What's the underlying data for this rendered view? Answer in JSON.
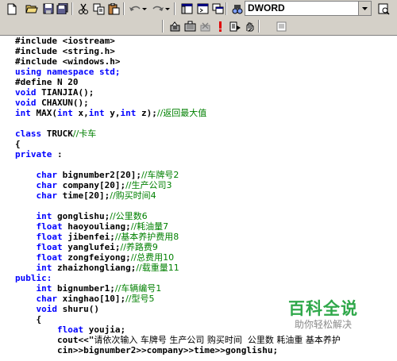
{
  "toolbar": {
    "config_combo": "DWORD",
    "icons": [
      "new-file-icon",
      "open-folder-icon",
      "save-icon",
      "save-all-icon",
      "cut-icon",
      "copy-icon",
      "paste-icon",
      "undo-icon",
      "redo-icon",
      "workspace-icon",
      "output-icon",
      "window-list-icon",
      "find-in-files-icon"
    ]
  },
  "code": [
    [
      {
        "t": "#include <iostream>"
      }
    ],
    [
      {
        "t": "#include <string.h>"
      }
    ],
    [
      {
        "t": "#include <windows.h>"
      }
    ],
    [
      {
        "t": "using namespace std;",
        "c": "kw"
      }
    ],
    [
      {
        "t": "#define N 20"
      }
    ],
    [
      {
        "t": "void",
        "c": "kw"
      },
      {
        "t": " TIANJIA();"
      }
    ],
    [
      {
        "t": "void",
        "c": "kw"
      },
      {
        "t": " CHAXUN();"
      }
    ],
    [
      {
        "t": "int",
        "c": "kw"
      },
      {
        "t": " MAX("
      },
      {
        "t": "int",
        "c": "kw"
      },
      {
        "t": " x,"
      },
      {
        "t": "int",
        "c": "kw"
      },
      {
        "t": " y,"
      },
      {
        "t": "int",
        "c": "kw"
      },
      {
        "t": " z);"
      },
      {
        "t": "//返回最大值",
        "c": "cm"
      }
    ],
    [
      {
        "t": ""
      }
    ],
    [
      {
        "t": "class",
        "c": "kw"
      },
      {
        "t": " TRUCK"
      },
      {
        "t": "//卡车",
        "c": "cm"
      }
    ],
    [
      {
        "t": "{"
      }
    ],
    [
      {
        "t": "private",
        "c": "kw"
      },
      {
        "t": " :"
      }
    ],
    [
      {
        "t": ""
      }
    ],
    [
      {
        "t": "    "
      },
      {
        "t": "char",
        "c": "kw"
      },
      {
        "t": " bignumber2[20];"
      },
      {
        "t": "//车牌号2",
        "c": "cm"
      }
    ],
    [
      {
        "t": "    "
      },
      {
        "t": "char",
        "c": "kw"
      },
      {
        "t": " company[20];"
      },
      {
        "t": "//生产公司3",
        "c": "cm"
      }
    ],
    [
      {
        "t": "    "
      },
      {
        "t": "char",
        "c": "kw"
      },
      {
        "t": " time[20];"
      },
      {
        "t": "//购买时间4",
        "c": "cm"
      }
    ],
    [
      {
        "t": ""
      }
    ],
    [
      {
        "t": "    "
      },
      {
        "t": "int",
        "c": "kw"
      },
      {
        "t": " gonglishu;"
      },
      {
        "t": "//公里数6",
        "c": "cm"
      }
    ],
    [
      {
        "t": "    "
      },
      {
        "t": "float",
        "c": "kw"
      },
      {
        "t": " haoyouliang;"
      },
      {
        "t": "//耗油量7",
        "c": "cm"
      }
    ],
    [
      {
        "t": "    "
      },
      {
        "t": "float",
        "c": "kw"
      },
      {
        "t": " jibenfei;"
      },
      {
        "t": "//基本养护费用8",
        "c": "cm"
      }
    ],
    [
      {
        "t": "    "
      },
      {
        "t": "float",
        "c": "kw"
      },
      {
        "t": " yanglufei;"
      },
      {
        "t": "//养路费9",
        "c": "cm"
      }
    ],
    [
      {
        "t": "    "
      },
      {
        "t": "float",
        "c": "kw"
      },
      {
        "t": " zongfeiyong;"
      },
      {
        "t": "//总费用10",
        "c": "cm"
      }
    ],
    [
      {
        "t": "    "
      },
      {
        "t": "int",
        "c": "kw"
      },
      {
        "t": " zhaizhongliang;"
      },
      {
        "t": "//载重量11",
        "c": "cm"
      }
    ],
    [
      {
        "t": "public:",
        "c": "kw"
      }
    ],
    [
      {
        "t": "    "
      },
      {
        "t": "int",
        "c": "kw"
      },
      {
        "t": " bignumber1;"
      },
      {
        "t": "//车辆编号1",
        "c": "cm"
      }
    ],
    [
      {
        "t": "    "
      },
      {
        "t": "char",
        "c": "kw"
      },
      {
        "t": " xinghao[10];"
      },
      {
        "t": "//型号5",
        "c": "cm"
      }
    ],
    [
      {
        "t": "    "
      },
      {
        "t": "void",
        "c": "kw"
      },
      {
        "t": " shuru()"
      }
    ],
    [
      {
        "t": "    {"
      }
    ],
    [
      {
        "t": "        "
      },
      {
        "t": "float",
        "c": "kw"
      },
      {
        "t": " youjia;"
      }
    ],
    [
      {
        "t": "        cout<<\""
      },
      {
        "t": "请依次输入 车牌号 生产公司 购买时间  公里数 耗油重 基本养护",
        "c": "ch"
      }
    ],
    [
      {
        "t": "        cin>>bignumber2>>company>>time>>gonglishu;"
      }
    ]
  ],
  "watermark": {
    "title": "百科全说",
    "subtitle": "助你轻松解决"
  }
}
